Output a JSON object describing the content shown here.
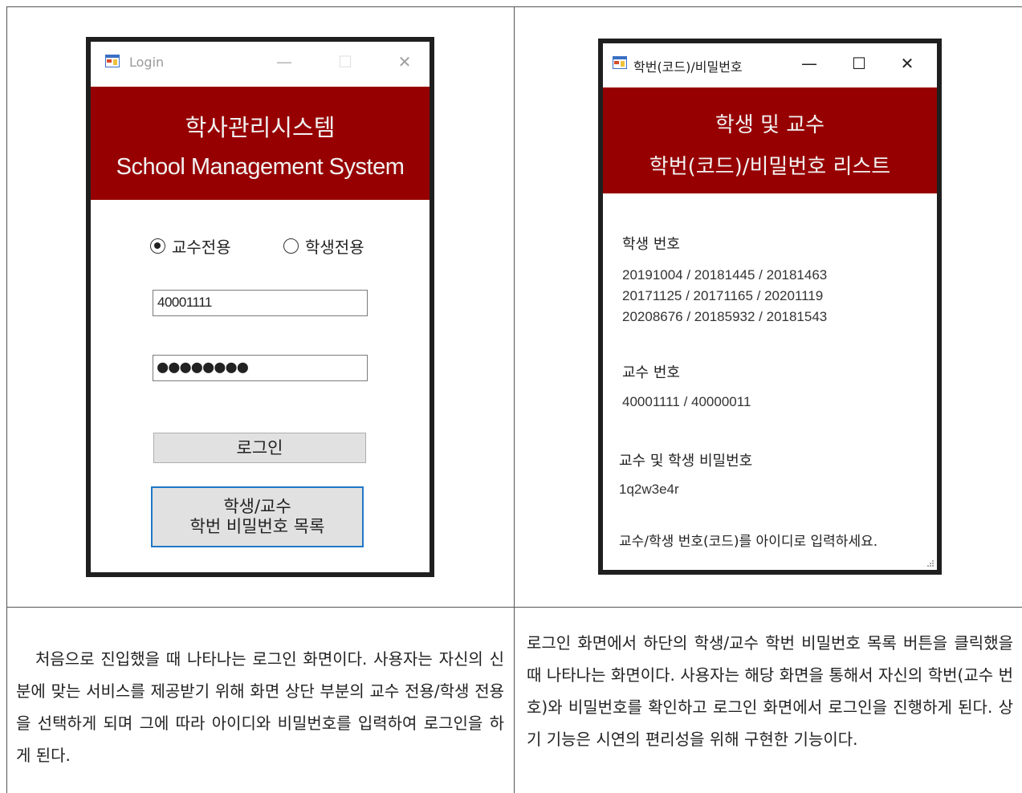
{
  "login_window": {
    "title": "Login",
    "icons": {
      "app": "app-icon",
      "minimize": "minimize-icon",
      "maximize": "maximize-icon",
      "close": "close-icon"
    },
    "controls": {
      "minimize": "—",
      "maximize": "☐",
      "close": "✕"
    },
    "banner": {
      "title_ko": "학사관리시스템",
      "title_en": "School Management System"
    },
    "radio_professor": "교수전용",
    "radio_student": "학생전용",
    "selected_role": "교수전용",
    "id_value": "40001111",
    "password_mask": "●●●●●●●●",
    "login_button": "로그인",
    "list_button_line1": "학생/교수",
    "list_button_line2": "학번 비밀번호 목록"
  },
  "list_window": {
    "title": "학번(코드)/비밀번호",
    "controls": {
      "minimize": "—",
      "maximize": "☐",
      "close": "✕"
    },
    "banner": {
      "line1": "학생 및 교수",
      "line2": "학번(코드)/비밀번호 리스트"
    },
    "student_label": "학생 번호",
    "student_numbers": [
      "20191004 / 20181445 / 20181463",
      "20171125 / 20171165 / 20201119",
      "20208676 / 20185932 / 20181543"
    ],
    "professor_label": "교수 번호",
    "professor_numbers": "40001111 / 40000011",
    "password_label": "교수 및 학생 비밀번호",
    "password_value": "1q2w3e4r",
    "hint": "교수/학생 번호(코드)를 아이디로 입력하세요."
  },
  "descriptions": {
    "left": "처음으로 진입했을 때 나타나는 로그인 화면이다. 사용자는 자신의 신분에 맞는 서비스를 제공받기 위해 화면 상단 부분의 교수 전용/학생 전용을 선택하게 되며 그에 따라 아이디와 비밀번호를 입력하여 로그인을 하게 된다.",
    "right": "로그인 화면에서 하단의 학생/교수 학번 비밀번호 목록 버튼을 클릭했을 때 나타나는 화면이다. 사용자는 해당 화면을 통해서 자신의 학번(교수 번호)와 비밀번호를 확인하고 로그인 화면에서 로그인을 진행하게 된다. 상기 기능은 시연의 편리성을 위해 구현한 기능이다."
  },
  "colors": {
    "banner": "#970000",
    "focus_border": "#1f78c8",
    "frame": "#1f1f1f"
  }
}
